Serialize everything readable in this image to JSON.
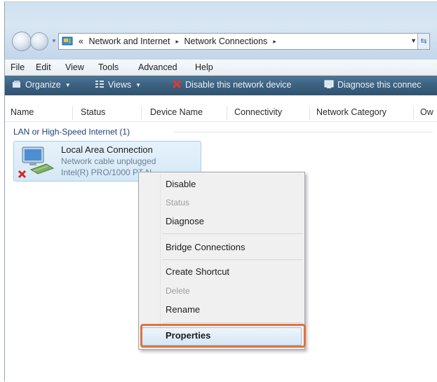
{
  "address": {
    "chevron": "«",
    "crumbs": [
      "Network and Internet",
      "Network Connections"
    ],
    "separator": "▸"
  },
  "menu": [
    "File",
    "Edit",
    "View",
    "Tools",
    "Advanced",
    "Help"
  ],
  "commands": {
    "organize": "Organize",
    "views": "Views",
    "disable": "Disable this network device",
    "diagnose": "Diagnose this connec"
  },
  "columns": [
    "Name",
    "Status",
    "Device Name",
    "Connectivity",
    "Network Category",
    "Ow"
  ],
  "group": {
    "title": "LAN or High-Speed Internet (1)"
  },
  "connection": {
    "name": "Local Area Connection",
    "status": "Network cable unplugged",
    "device": "Intel(R) PRO/1000 PT N"
  },
  "context_menu": {
    "items": [
      "Disable",
      "Status",
      "Diagnose",
      "Bridge Connections",
      "Create Shortcut",
      "Delete",
      "Rename",
      "Properties"
    ],
    "disabled": [
      "Status",
      "Delete"
    ],
    "highlighted": "Properties"
  },
  "colors": {
    "command_bar": "#3c6180",
    "callout_border": "#e0733e",
    "group_title": "#1e3f7c"
  }
}
